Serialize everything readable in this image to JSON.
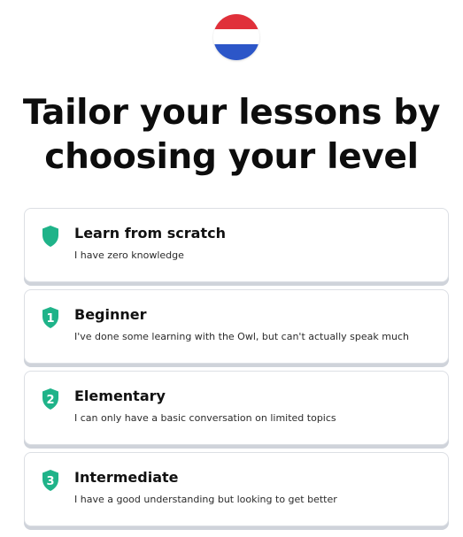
{
  "flag": {
    "icon": "netherlands-flag-icon",
    "colors": [
      "#e0303a",
      "#ffffff",
      "#2c56c8"
    ]
  },
  "title": {
    "line1": "Tailor your lessons by",
    "line2": "choosing your level"
  },
  "accent_color": "#1fb389",
  "levels": [
    {
      "label": "Learn from scratch",
      "description": "I have zero knowledge",
      "icon": "shield-icon",
      "badge": ""
    },
    {
      "label": "Beginner",
      "description": "I've done some learning with the Owl, but can't actually speak much",
      "icon": "shield-1-icon",
      "badge": "1"
    },
    {
      "label": "Elementary",
      "description": "I can only have a basic conversation on limited topics",
      "icon": "shield-2-icon",
      "badge": "2"
    },
    {
      "label": "Intermediate",
      "description": "I have a good understanding but looking to get better",
      "icon": "shield-3-icon",
      "badge": "3"
    }
  ]
}
